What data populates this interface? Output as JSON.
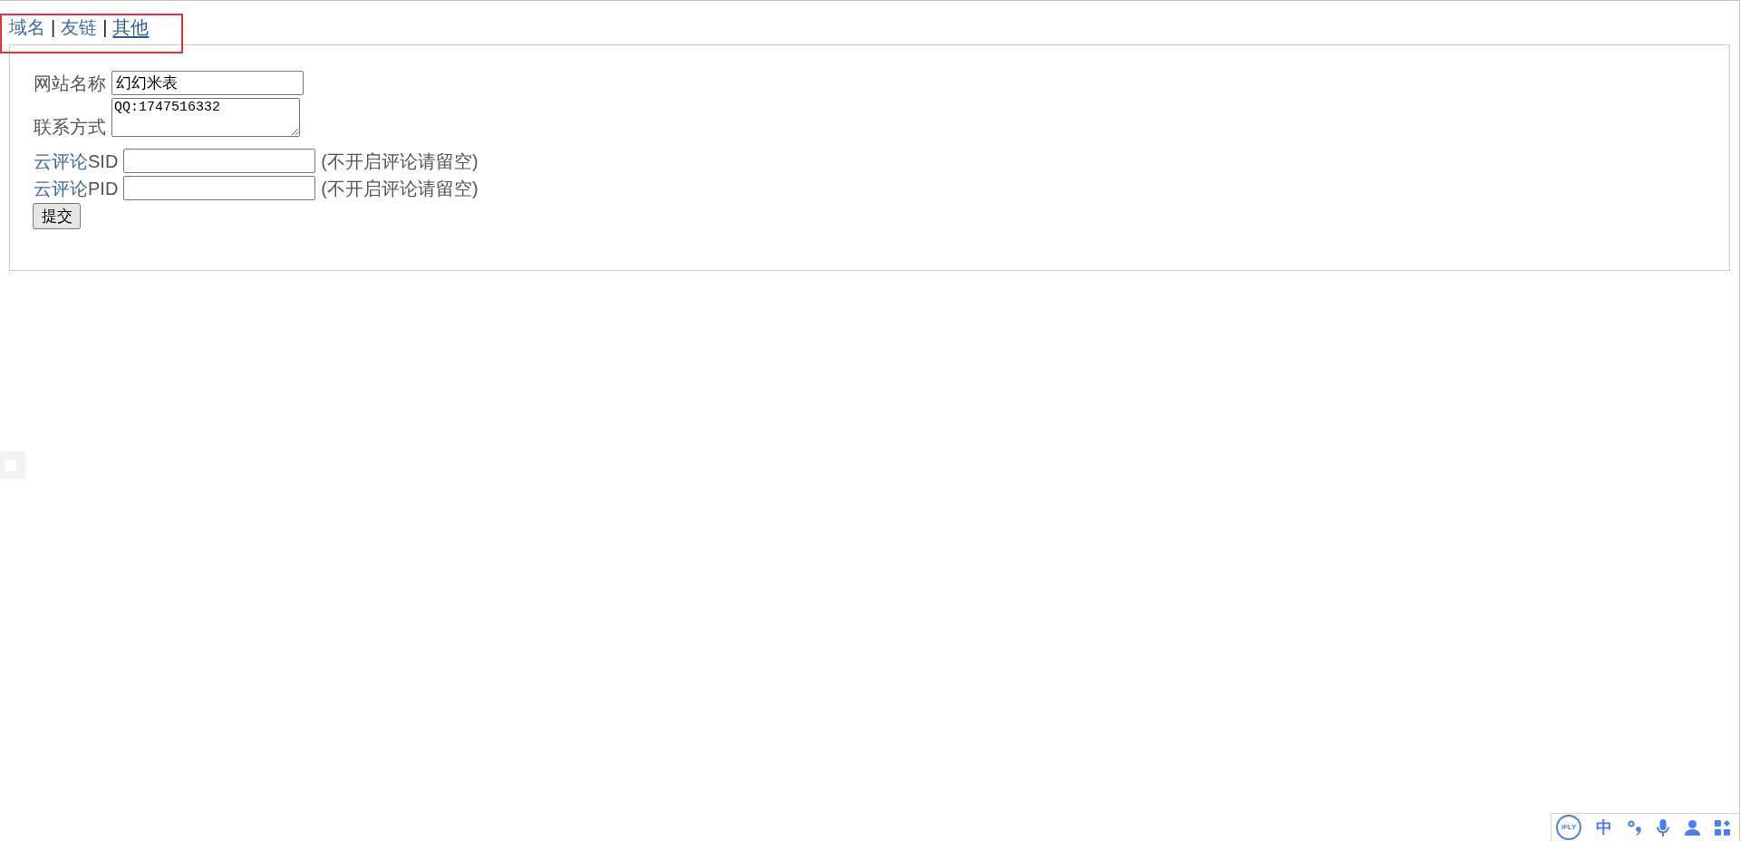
{
  "nav": {
    "items": [
      {
        "kind": "link",
        "label": "域名",
        "selected": false
      },
      {
        "kind": "separator",
        "text": "|"
      },
      {
        "kind": "link",
        "label": "友链",
        "selected": false
      },
      {
        "kind": "separator",
        "text": "|"
      },
      {
        "kind": "link",
        "label": "其他",
        "selected": true
      }
    ]
  },
  "form": {
    "fields": [
      {
        "kind": "input",
        "label": "网站名称",
        "value": "幻幻米表"
      },
      {
        "kind": "textarea",
        "label": "联系方式",
        "value": "QQ:1747516332"
      },
      {
        "kind": "input",
        "label_link": "云评论",
        "label": "SID",
        "hint": "(不开启评论请留空)"
      },
      {
        "kind": "input",
        "label_link": "云评论",
        "label": "PID",
        "hint": "(不开启评论请留空)"
      }
    ],
    "submit": {
      "label": "提交"
    }
  },
  "ime_toolbar": {
    "logo": "iFLY",
    "mode": "中"
  }
}
